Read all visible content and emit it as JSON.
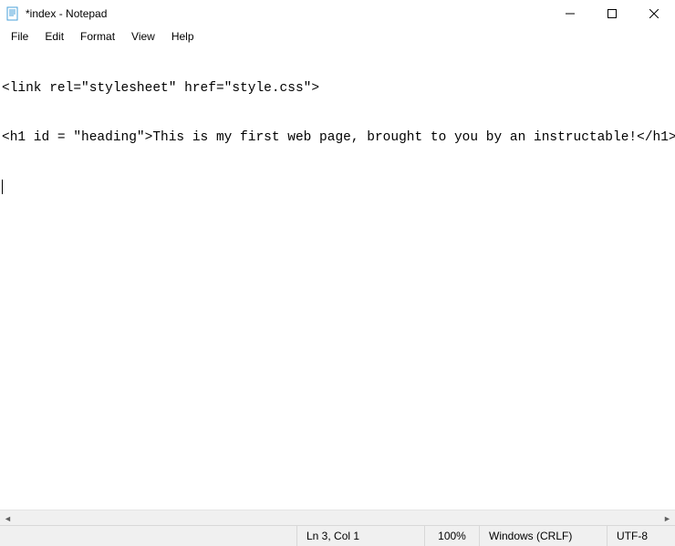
{
  "titlebar": {
    "title": "*index - Notepad"
  },
  "menubar": {
    "items": [
      "File",
      "Edit",
      "Format",
      "View",
      "Help"
    ]
  },
  "editor": {
    "lines": [
      "<link rel=\"stylesheet\" href=\"style.css\">",
      "<h1 id = \"heading\">This is my first web page, brought to you by an instructable!</h1>"
    ]
  },
  "statusbar": {
    "position": "Ln 3, Col 1",
    "zoom": "100%",
    "line_ending": "Windows (CRLF)",
    "encoding": "UTF-8"
  }
}
